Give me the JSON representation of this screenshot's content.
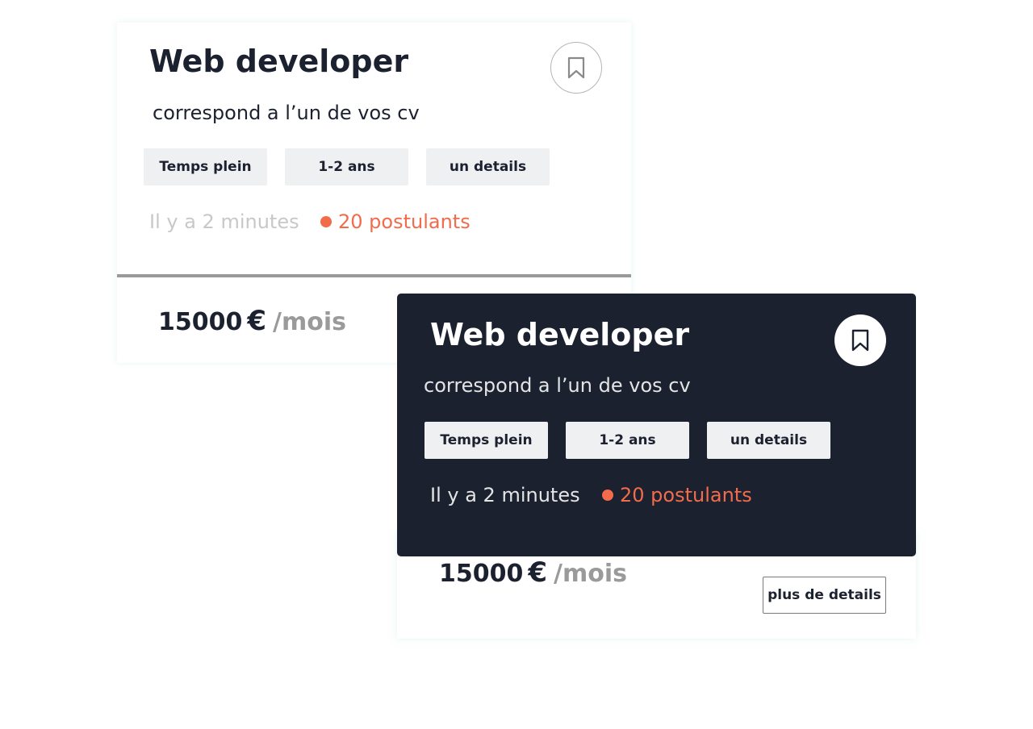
{
  "colors": {
    "dark_card": "#1c2130",
    "accent": "#f26b4b",
    "tag_bg": "#eff0f2",
    "muted_text": "#9a9a9a"
  },
  "cards": [
    {
      "theme": "light",
      "title": "Web developer",
      "subtitle": "correspond a l’un de vos cv",
      "bookmark_icon": "bookmark-icon",
      "tags": [
        "Temps plein",
        "1-2 ans",
        "un details"
      ],
      "posted": "Il y a 2 minutes",
      "applicants": "20 postulants",
      "salary": {
        "amount": "15000",
        "currency": "€",
        "period": "/mois"
      }
    },
    {
      "theme": "dark",
      "title": "Web developer",
      "subtitle": "correspond a l’un de vos cv",
      "bookmark_icon": "bookmark-icon",
      "tags": [
        "Temps plein",
        "1-2 ans",
        "un details"
      ],
      "posted": "Il y a 2 minutes",
      "applicants": "20 postulants",
      "salary": {
        "amount": "15000",
        "currency": "€",
        "period": "/mois"
      },
      "more_button": "plus de details"
    }
  ]
}
